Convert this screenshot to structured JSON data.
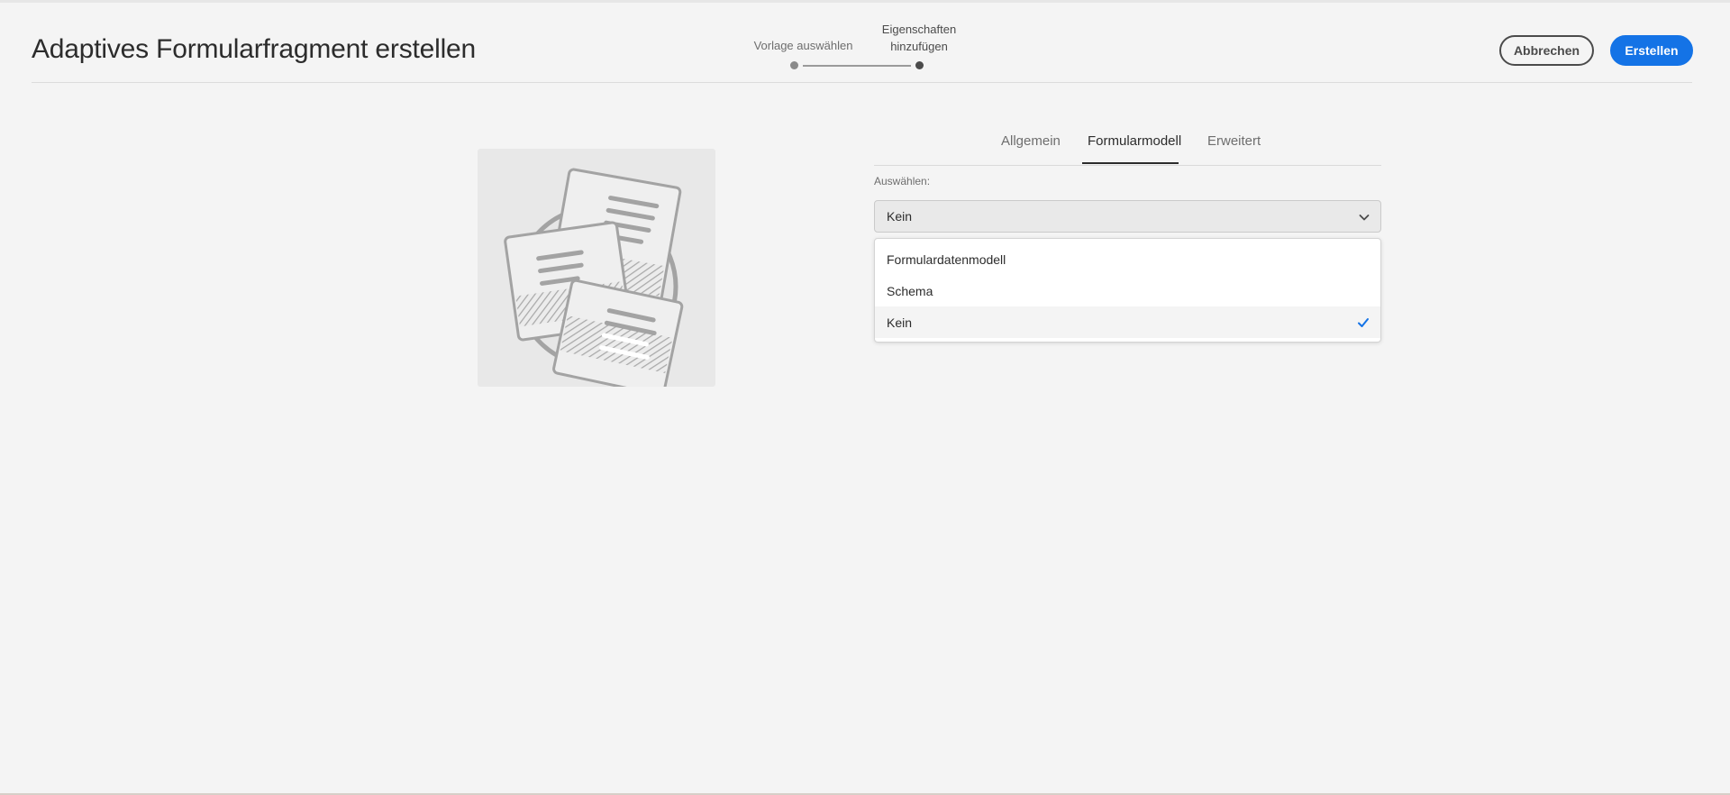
{
  "header": {
    "title": "Adaptives Formularfragment erstellen"
  },
  "wizard": {
    "steps": [
      {
        "label": "Vorlage auswählen",
        "state": "completed"
      },
      {
        "label_line1": "Eigenschaften",
        "label_line2": "hinzufügen",
        "state": "current"
      }
    ]
  },
  "actions": {
    "cancel_label": "Abbrechen",
    "create_label": "Erstellen"
  },
  "tabs": [
    {
      "label": "Allgemein",
      "selected": false
    },
    {
      "label": "Formularmodell",
      "selected": true
    },
    {
      "label": "Erweitert",
      "selected": false
    }
  ],
  "form_model": {
    "select_label": "Auswählen:",
    "selected_value": "Kein",
    "options": [
      {
        "label": "Formulardatenmodell",
        "selected": false
      },
      {
        "label": "Schema",
        "selected": false
      },
      {
        "label": "Kein",
        "selected": true
      }
    ]
  },
  "thumbnail": {
    "icon": "form-fragment-illustration-icon"
  },
  "colors": {
    "accent": "#1473e6",
    "background": "#f4f4f4",
    "text": "#2c2c2c"
  }
}
